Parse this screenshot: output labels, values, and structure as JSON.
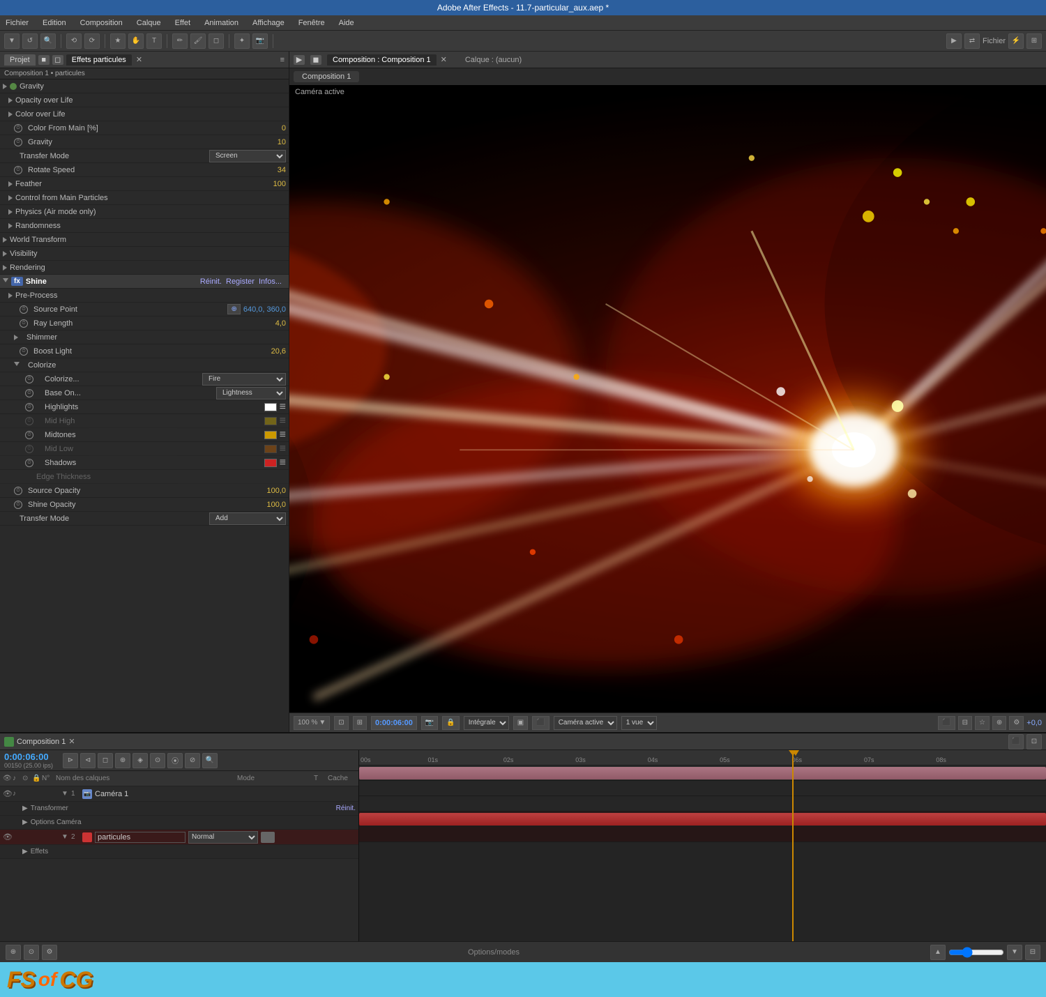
{
  "app": {
    "title": "Adobe After Effects - 11.7-particular_aux.aep *",
    "menu": [
      "Fichier",
      "Edition",
      "Composition",
      "Calque",
      "Effet",
      "Animation",
      "Affichage",
      "Fenêtre",
      "Aide"
    ]
  },
  "panels": {
    "project_tab": "Projet",
    "effects_tab": "Effets particules",
    "comp_info": "Composition 1 • particules"
  },
  "effects": {
    "properties": [
      {
        "label": "Gravity",
        "value": "",
        "indent": 1,
        "type": "section"
      },
      {
        "label": "Opacity over Life",
        "value": "",
        "indent": 1,
        "type": "section"
      },
      {
        "label": "Color over Life",
        "value": "",
        "indent": 1,
        "type": "section"
      },
      {
        "label": "Color From Main [%]",
        "value": "0",
        "indent": 1,
        "valueColor": "yellow"
      },
      {
        "label": "Gravity",
        "value": "10",
        "indent": 1,
        "valueColor": "yellow"
      },
      {
        "label": "Transfer Mode",
        "value": "Screen",
        "indent": 1,
        "type": "dropdown"
      },
      {
        "label": "Rotate Speed",
        "value": "34",
        "indent": 1,
        "valueColor": "yellow"
      },
      {
        "label": "Feather",
        "value": "100",
        "indent": 1,
        "valueColor": "yellow"
      },
      {
        "label": "Control from Main Particles",
        "value": "",
        "indent": 1,
        "type": "section"
      },
      {
        "label": "Physics (Air mode only)",
        "value": "",
        "indent": 1,
        "type": "section"
      },
      {
        "label": "Randomness",
        "value": "",
        "indent": 1,
        "type": "section"
      },
      {
        "label": "World Transform",
        "value": "",
        "indent": 0,
        "type": "section"
      },
      {
        "label": "Visibility",
        "value": "",
        "indent": 0,
        "type": "section"
      },
      {
        "label": "Rendering",
        "value": "",
        "indent": 0,
        "type": "section"
      }
    ],
    "shine": {
      "name": "Shine",
      "reinit": "Réinit.",
      "register": "Register",
      "infos": "Infos...",
      "properties": [
        {
          "label": "Pre-Process",
          "value": "",
          "indent": 1,
          "type": "section"
        },
        {
          "label": "Source Point",
          "value": "640,0, 360,0",
          "indent": 2,
          "type": "point"
        },
        {
          "label": "Ray Length",
          "value": "4,0",
          "indent": 2,
          "valueColor": "yellow"
        },
        {
          "label": "Shimmer",
          "value": "",
          "indent": 2,
          "type": "section"
        },
        {
          "label": "Boost Light",
          "value": "20,6",
          "indent": 2,
          "valueColor": "yellow"
        },
        {
          "label": "Colorize",
          "value": "",
          "indent": 2,
          "type": "section",
          "open": true
        },
        {
          "label": "Colorize...",
          "value": "Fire",
          "indent": 3,
          "type": "dropdown-color"
        },
        {
          "label": "Base On...",
          "value": "Lightness",
          "indent": 3,
          "type": "dropdown"
        },
        {
          "label": "Highlights",
          "value": "",
          "indent": 3,
          "type": "color-row"
        },
        {
          "label": "Mid High",
          "value": "",
          "indent": 3,
          "type": "color-row-disabled"
        },
        {
          "label": "Midtones",
          "value": "",
          "indent": 3,
          "type": "color-row"
        },
        {
          "label": "Mid Low",
          "value": "",
          "indent": 3,
          "type": "color-row-disabled"
        },
        {
          "label": "Shadows",
          "value": "",
          "indent": 3,
          "type": "color-row"
        },
        {
          "label": "Edge Thickness",
          "value": "",
          "indent": 3,
          "type": "disabled"
        },
        {
          "label": "Source Opacity",
          "value": "100,0",
          "indent": 2,
          "valueColor": "yellow"
        },
        {
          "label": "Shine Opacity",
          "value": "100,0",
          "indent": 2,
          "valueColor": "yellow"
        },
        {
          "label": "Transfer Mode",
          "value": "Add",
          "indent": 2,
          "type": "dropdown"
        }
      ]
    }
  },
  "composition": {
    "tab_label": "Composition : Composition 1",
    "layer_tab": "Calque : (aucun)",
    "comp_tab": "Composition 1",
    "camera_label": "Caméra active",
    "zoom": "100 %",
    "timecode": "0:00:06:00",
    "fps": "Intégrale",
    "view": "Caméra active",
    "views_count": "1 vue"
  },
  "timeline": {
    "tab_label": "Composition 1",
    "timecode": "0:00:06:00",
    "fps_label": "00150 (25.00 ips)",
    "time_markers": [
      "00s",
      "01s",
      "02s",
      "03s",
      "04s",
      "05s",
      "06s",
      "07s",
      "08s"
    ],
    "layer_columns": [
      "N°",
      "Nom des calques",
      "Mode",
      "T",
      "Cache"
    ],
    "layers": [
      {
        "num": "1",
        "name": "Caméra 1",
        "mode": "",
        "type": "camera",
        "color": "blue",
        "children": [
          {
            "label": "Transformer",
            "action": "Réinit."
          },
          {
            "label": "Options Caméra"
          }
        ]
      },
      {
        "num": "2",
        "name": "particules",
        "mode": "Normal",
        "type": "solid",
        "color": "red",
        "children": [
          {
            "label": "Effets"
          }
        ]
      }
    ]
  },
  "status": {
    "options_modes": "Options/modes"
  },
  "brand": {
    "text1": "FS",
    "text2": "of",
    "text3": "CG"
  },
  "colors": {
    "highlight_white": "#ffffff",
    "highlight_yellow": "#ddbb00",
    "midtone_yellow": "#cc9900",
    "shadow_red": "#cc2222",
    "accent_blue": "#2c5f9e",
    "playhead_color": "#cc8800"
  }
}
